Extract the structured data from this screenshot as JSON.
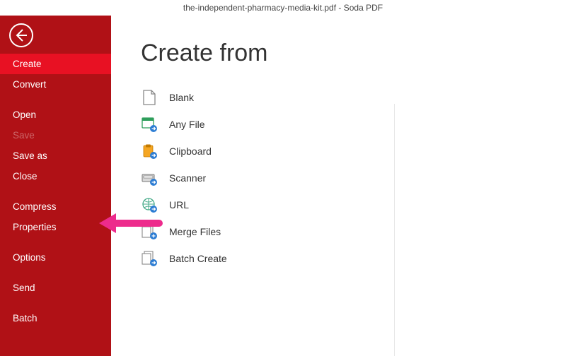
{
  "titlebar": {
    "filename": "the-independent-pharmacy-media-kit.pdf",
    "sep": "   -   ",
    "app": "Soda PDF"
  },
  "sidebar": {
    "create": "Create",
    "convert": "Convert",
    "open": "Open",
    "save": "Save",
    "saveas": "Save as",
    "close": "Close",
    "compress": "Compress",
    "properties": "Properties",
    "options": "Options",
    "send": "Send",
    "batch": "Batch"
  },
  "main": {
    "heading": "Create from",
    "blank": "Blank",
    "anyfile": "Any File",
    "clipboard": "Clipboard",
    "scanner": "Scanner",
    "url": "URL",
    "merge": "Merge Files",
    "batchcreate": "Batch Create"
  },
  "colors": {
    "sidebar": "#b01116",
    "active": "#e81123",
    "arrow": "#ed2b8c",
    "accent": "#2b7cd3"
  }
}
